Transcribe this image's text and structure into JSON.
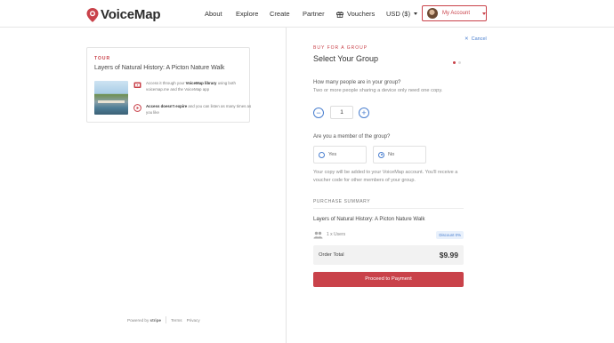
{
  "header": {
    "logo_text": "VoiceMap",
    "nav": {
      "about": "About",
      "explore": "Explore",
      "create": "Create",
      "partner": "Partner",
      "vouchers": "Vouchers",
      "currency": "USD ($)"
    },
    "account_label": "My Account"
  },
  "tour": {
    "tag": "TOUR",
    "title": "Layers of Natural History: A Picton Nature Walk",
    "features": [
      {
        "prefix": "Access it through your ",
        "strong": "VoiceMap library",
        "suffix": " using both voicemap.me and the VoiceMap app"
      },
      {
        "prefix": "",
        "strong": "Access doesn't expire",
        "suffix": " and you can listen as many times as you like"
      }
    ]
  },
  "footer": {
    "powered_by": "Powered by",
    "stripe": "stripe",
    "terms": "Terms",
    "privacy": "Privacy"
  },
  "panel": {
    "cancel": "Cancel",
    "eyebrow": "BUY FOR A GROUP",
    "title": "Select Your Group",
    "steps_total": 2,
    "step_active": 1,
    "question_people": "How many people are in your group?",
    "question_people_sub": "Two or more people sharing a device only need one copy.",
    "quantity": "1",
    "question_member": "Are you a member of the group?",
    "options": {
      "yes": "Yes",
      "no": "No"
    },
    "selected_option": "no",
    "note": "Your copy will be added to your VoiceMap account. You'll receive a voucher code for other members of your group.",
    "summary_label": "PURCHASE SUMMARY",
    "summary_title": "Layers of Natural History: A Picton Nature Walk",
    "users": "1 x Users",
    "discount": "Discount 0%",
    "order_total_label": "Order Total",
    "order_total_value": "$9.99",
    "proceed": "Proceed to Payment"
  },
  "colors": {
    "brand": "#c9424a",
    "link": "#4a7fcf"
  },
  "icons": [
    "voicemap-pin-logo-icon",
    "gift-icon",
    "chevron-down-icon",
    "library-icon",
    "play-icon",
    "close-icon",
    "minus-icon",
    "plus-icon",
    "users-icon"
  ]
}
